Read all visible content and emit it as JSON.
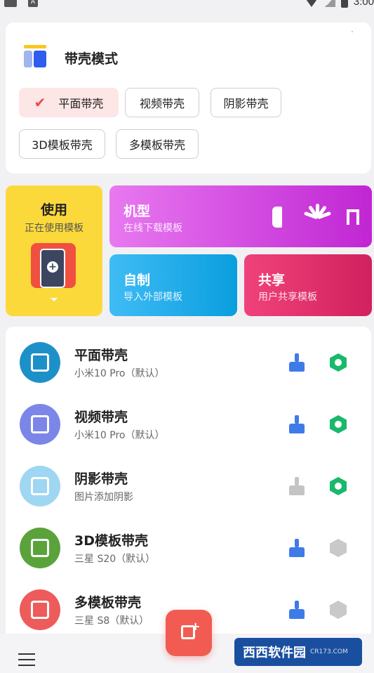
{
  "status_bar": {
    "time": "3:00"
  },
  "mode_card": {
    "title": "带壳模式",
    "options": [
      {
        "label": "平面带壳",
        "selected": true
      },
      {
        "label": "视频带壳",
        "selected": false
      },
      {
        "label": "阴影带壳",
        "selected": false
      },
      {
        "label": "3D模板带壳",
        "selected": false
      },
      {
        "label": "多模板带壳",
        "selected": false
      }
    ]
  },
  "tiles": {
    "use": {
      "title": "使用",
      "subtitle": "正在使用模板"
    },
    "model": {
      "title": "机型",
      "subtitle": "在线下载模板"
    },
    "custom": {
      "title": "自制",
      "subtitle": "导入外部模板"
    },
    "share": {
      "title": "共享",
      "subtitle": "用户共享模板"
    }
  },
  "list": [
    {
      "title": "平面带壳",
      "subtitle": "小米10 Pro（默认）",
      "icon": "image-icon",
      "icon_color": "#1e90c8",
      "brush_active": true,
      "hex_active": true
    },
    {
      "title": "视频带壳",
      "subtitle": "小米10 Pro（默认）",
      "icon": "video-icon",
      "icon_color": "#7b86e8",
      "brush_active": true,
      "hex_active": true
    },
    {
      "title": "阴影带壳",
      "subtitle": "图片添加阴影",
      "icon": "shadow-image-icon",
      "icon_color": "#9fd6f2",
      "brush_active": false,
      "hex_active": true
    },
    {
      "title": "3D模板带壳",
      "subtitle": "三星 S20（默认）",
      "icon": "cube-icon",
      "icon_color": "#5aa33a",
      "brush_active": true,
      "hex_active": false
    },
    {
      "title": "多模板带壳",
      "subtitle": "三星 S8（默认）",
      "icon": "multi-image-icon",
      "icon_color": "#ee5b5b",
      "brush_active": true,
      "hex_active": false
    }
  ],
  "colors": {
    "brush_active": "#3f7be8",
    "brush_inactive": "#c4c4c4",
    "hex_active": "#19b96b",
    "hex_inactive": "#c9c9c9",
    "accent": "#f25b52"
  },
  "watermark": {
    "text": "西西软件园",
    "sub": "CR173.COM"
  }
}
